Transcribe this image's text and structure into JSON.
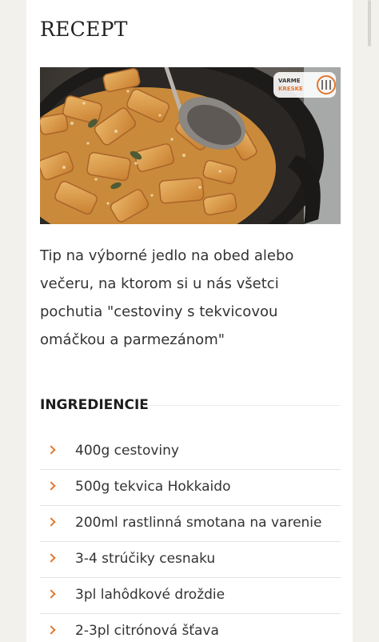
{
  "recipe": {
    "title": "RECEPT",
    "image_alt": "cestoviny s tekvicovou omáčkou a parmezánom",
    "logo_text": "VARME KRESKE",
    "description": "Tip na výborné jedlo na obed alebo večeru, na ktorom si u nás všetci pochutia \"cestoviny s tekvicovou omáčkou a parmezánom\""
  },
  "ingredients": {
    "heading": "INGREDIENCIE",
    "items": [
      {
        "label": "400g cestoviny",
        "icon": "chevron-right-icon"
      },
      {
        "label": "500g tekvica Hokkaido",
        "icon": "chevron-right-icon"
      },
      {
        "label": "200ml rastlinná smotana na varenie",
        "icon": "chevron-right-icon"
      },
      {
        "label": "3-4 strúčiky cesnaku",
        "icon": "chevron-right-icon"
      },
      {
        "label": "3pl lahôdkové droždie",
        "icon": "chevron-right-icon"
      },
      {
        "label": "2-3pl citrónová šťava",
        "icon": "chevron-right-icon"
      }
    ]
  },
  "colors": {
    "accent": "#e2762f",
    "background": "#f3f1ec",
    "card": "#ffffff",
    "text": "#333333"
  }
}
